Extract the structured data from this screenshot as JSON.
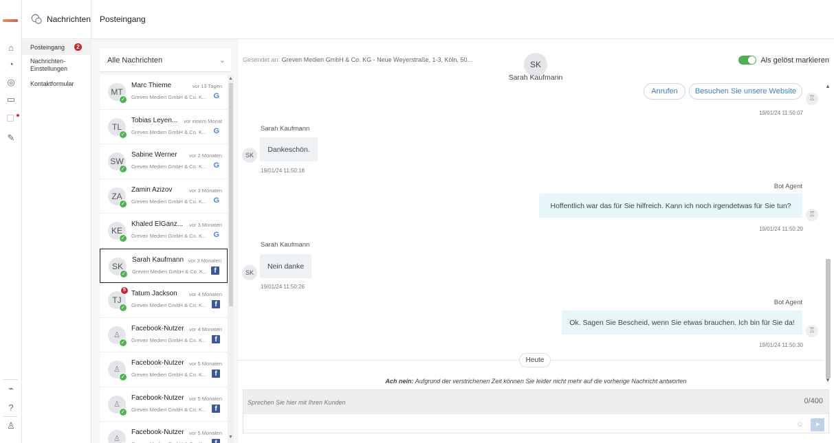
{
  "app": {
    "section_title": "Nachrichten",
    "page_title": "Posteingang"
  },
  "nav": {
    "items": [
      {
        "label": "Posteingang",
        "badge": "2"
      },
      {
        "label": "Nachrichten-Einstellungen",
        "line1": "Nachrichten-",
        "line2": "Einstellungen"
      },
      {
        "label": "Kontaktformular"
      }
    ]
  },
  "filter": {
    "label": "Alle Nachrichten"
  },
  "conversations": [
    {
      "initials": "MT",
      "name": "Marc Thieme",
      "time": "vor 13 Tagen",
      "company": "Greven Medien GmbH & Co. K...",
      "channel": "google",
      "channel_glyph": "G"
    },
    {
      "initials": "TL",
      "name": "Tobias Leyen...",
      "time": "vor einem Monat",
      "company": "Greven Medien GmbH & Co. K...",
      "channel": "google",
      "channel_glyph": "G"
    },
    {
      "initials": "SW",
      "name": "Sabine Werner",
      "time": "vor 2 Monaten",
      "company": "Greven Medien GmbH & Co. K...",
      "channel": "google",
      "channel_glyph": "G"
    },
    {
      "initials": "ZA",
      "name": "Zamin Azizov",
      "time": "vor 3 Monaten",
      "company": "Greven Medien GmbH & Co. K...",
      "channel": "google",
      "channel_glyph": "G"
    },
    {
      "initials": "KE",
      "name": "Khaled ElGanz...",
      "time": "vor 3 Monaten",
      "company": "Greven Medien GmbH & Co. K...",
      "channel": "google",
      "channel_glyph": "G"
    },
    {
      "initials": "SK",
      "name": "Sarah Kaufmann",
      "time": "vor 3 Monaten",
      "company": "Greven Medien GmbH & Co. K...",
      "channel": "facebook",
      "channel_glyph": "f"
    },
    {
      "initials": "TJ",
      "name": "Tatum Jackson",
      "time": "vor 4 Monaten",
      "company": "Greven Medien GmbH & Co. K...",
      "channel": "facebook",
      "channel_glyph": "f",
      "unread": "5"
    },
    {
      "initials": "",
      "name": "Facebook-Nutzer",
      "time": "vor 4 Monaten",
      "company": "Greven Medien GmbH & Co. K...",
      "channel": "facebook",
      "channel_glyph": "f"
    },
    {
      "initials": "",
      "name": "Facebook-Nutzer",
      "time": "vor 5 Monaten",
      "company": "Greven Medien GmbH & Co. K...",
      "channel": "facebook",
      "channel_glyph": "f"
    },
    {
      "initials": "",
      "name": "Facebook-Nutzer",
      "time": "vor 5 Monaten",
      "company": "Greven Medien GmbH & Co. K...",
      "channel": "facebook",
      "channel_glyph": "f"
    },
    {
      "initials": "",
      "name": "Facebook-Nutzer",
      "time": "vor 5 Monaten",
      "company": "Greven Medien GmbH & Co. K...",
      "channel": "facebook",
      "channel_glyph": "f"
    }
  ],
  "chat": {
    "sent_to_label": "Gesendet an:",
    "sent_to_value": "Greven Medien GmbH & Co. KG - Neue Weyerstraße, 1-3, Köln, 50...",
    "contact_initials": "SK",
    "contact_name": "Sarah Kaufmann",
    "resolve_label": "Als gelöst markieren",
    "resolved": true,
    "buttons": {
      "call": "Anrufen",
      "visit": "Besuchen Sie unsere Website"
    },
    "messages": [
      {
        "from": "bot",
        "time": "19/01/24 11:50:07"
      },
      {
        "from": "user",
        "sender": "Sarah Kaufmann",
        "initials": "SK",
        "text": "Dankeschön.",
        "time": "19/01/24 11:50:18"
      },
      {
        "from": "bot",
        "sender": "Bot Agent",
        "text": "Hoffentlich war das für Sie hilfreich. Kann ich noch irgendetwas für Sie tun?",
        "time": "19/01/24 11:50:20"
      },
      {
        "from": "user",
        "sender": "Sarah Kaufmann",
        "initials": "SK",
        "text": "Nein danke",
        "time": "19/01/24 11:50:26"
      },
      {
        "from": "bot",
        "sender": "Bot Agent",
        "text": "Ok. Sagen Sie Bescheid, wenn Sie etwas brauchen. Ich bin für Sie da!",
        "time": "19/01/24 11:50:30"
      }
    ],
    "divider": "Heute",
    "warning_bold": "Ach nein:",
    "warning_text": " Aufgrund der verstrichenen Zeit können Sie leider nicht mehr auf die vorherige Nachricht antworten",
    "composer_placeholder": "Sprechen Sie hier mit Ihren Kunden",
    "char_count": "0/400"
  },
  "colors": {
    "accent": "#4caf50",
    "badge": "#c9252e",
    "link": "#3f7fc6",
    "facebook": "#3b5998",
    "google": "#4285f4"
  }
}
